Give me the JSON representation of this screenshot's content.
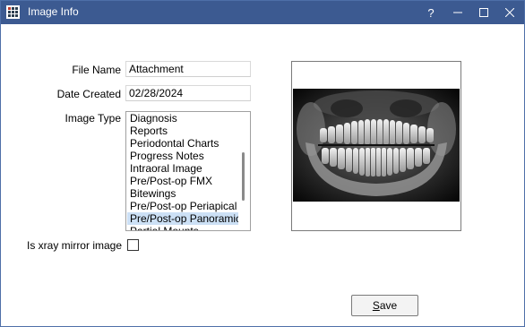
{
  "window": {
    "title": "Image Info",
    "help_label": "?",
    "minimize_label": "—",
    "maximize_label": "☐",
    "close_label": "✕"
  },
  "form": {
    "file_name_label": "File Name",
    "file_name_value": "Attachment",
    "date_created_label": "Date Created",
    "date_created_value": "02/28/2024",
    "image_type_label": "Image Type",
    "image_type_options": [
      "Diagnosis",
      "Reports",
      "Periodontal Charts",
      "Progress Notes",
      "Intraoral Image",
      "Pre/Post-op FMX",
      "Bitewings",
      "Pre/Post-op Periapical",
      "Pre/Post-op  Panoramic",
      "Partial Mounts"
    ],
    "image_type_selected": "Pre/Post-op  Panoramic",
    "xray_mirror_label": "Is xray mirror image",
    "xray_mirror_checked": false
  },
  "preview": {
    "image_description": "panoramic dental x-ray"
  },
  "buttons": {
    "save_label_underlined": "S",
    "save_label_rest": "ave"
  },
  "colors": {
    "titlebar": "#3c5a91",
    "selected_item": "#cce0f5"
  }
}
